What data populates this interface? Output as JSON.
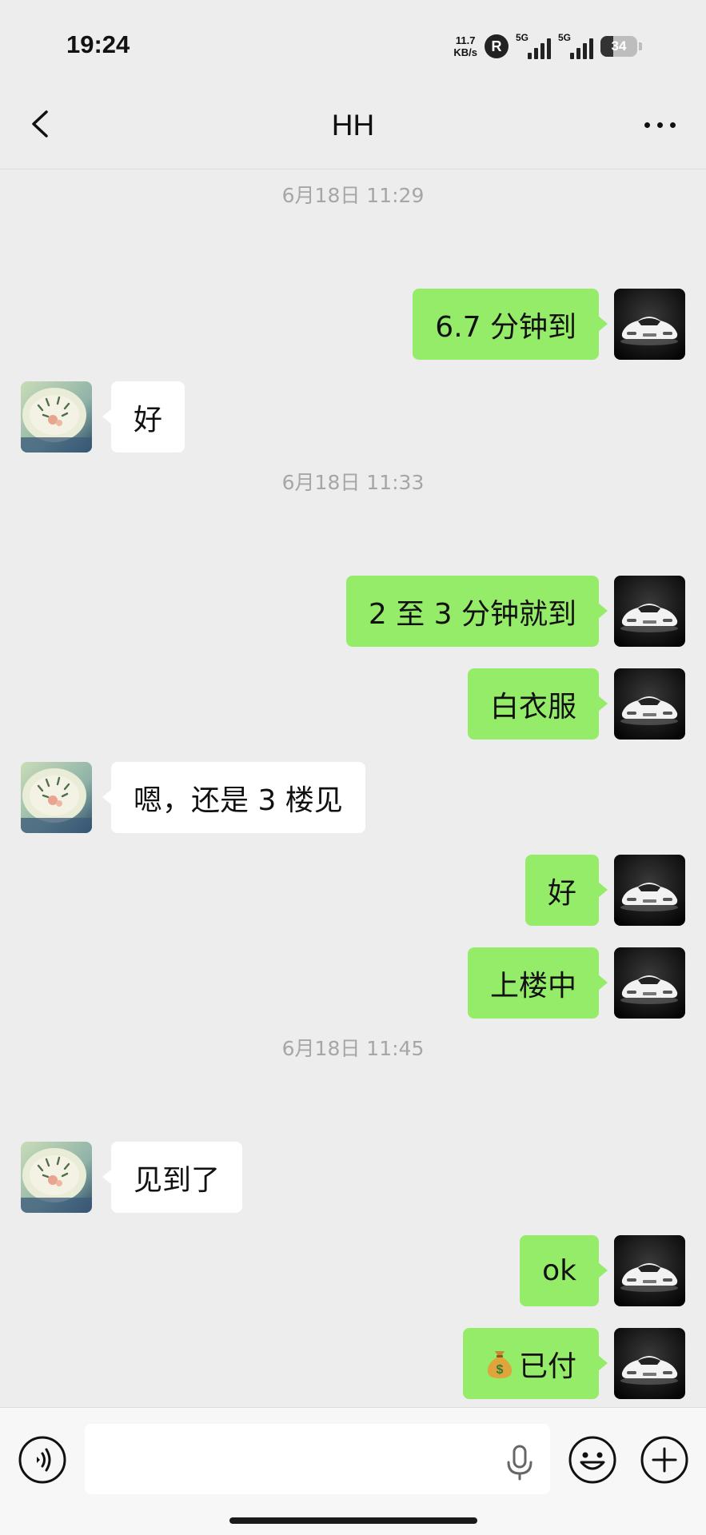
{
  "status_bar": {
    "time": "19:24",
    "net_speed_value": "11.7",
    "net_speed_unit": "KB/s",
    "roaming_badge": "R",
    "signal_1_label": "5G",
    "signal_2_label": "5G",
    "battery_level": "34"
  },
  "nav": {
    "title": "HH",
    "back_icon": "chevron-left-icon",
    "more_icon": "more-dots-icon"
  },
  "messages": {
    "ts1": "6月18日 11:29",
    "m1": "6.7 分钟到",
    "m2": "好",
    "ts2": "6月18日 11:33",
    "m3": "2 至 3 分钟就到",
    "m4": "白衣服",
    "m5": "嗯，还是 3 楼见",
    "m6": "好",
    "m7": "上楼中",
    "ts3": "6月18日 11:45",
    "m8": "见到了",
    "m9": "ok",
    "m10": "已付"
  },
  "input_bar": {
    "voice_icon": "voice-input-icon",
    "mic_icon": "microphone-icon",
    "emoji_icon": "emoji-icon",
    "plus_icon": "plus-circle-icon",
    "text_value": ""
  },
  "colors": {
    "outgoing_bubble": "#95ec69",
    "incoming_bubble": "#ffffff",
    "background": "#ededed"
  }
}
